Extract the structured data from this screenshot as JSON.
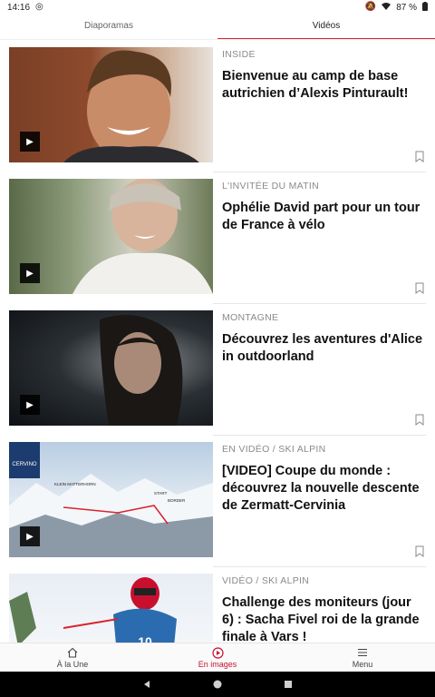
{
  "status_bar": {
    "time": "14:16",
    "battery": "87 %"
  },
  "tabs": [
    {
      "label": "Diaporamas",
      "active": false
    },
    {
      "label": "Vidéos",
      "active": true
    }
  ],
  "articles": [
    {
      "category": "INSIDE",
      "title": "Bienvenue au camp de base autrichien d’Alexis Pinturault!"
    },
    {
      "category": "L'INVITÉE DU MATIN",
      "title": "Ophélie David part pour un tour de France à vélo"
    },
    {
      "category": "MONTAGNE",
      "title": "Découvrez les aventures d'Alice in outdoorland"
    },
    {
      "category": "EN VIDÉO / SKI ALPIN",
      "title": "[VIDEO] Coupe du monde : découvrez la nouvelle descente de Zermatt-Cervinia"
    },
    {
      "category": "VIDÉO / SKI ALPIN",
      "title": "Challenge des moniteurs (jour 6) : Sacha Fivel roi de la grande finale à Vars !"
    }
  ],
  "thumb4_labels": {
    "zermatt_logo": "CERVINO",
    "klein": "KLEIN MATTERHORN",
    "start": "START",
    "border": "BORDER"
  },
  "thumb5_bib": "10",
  "bottom_nav": [
    {
      "label": "À la Une",
      "icon": "home-icon",
      "active": false
    },
    {
      "label": "En images",
      "icon": "play-circle-icon",
      "active": true
    },
    {
      "label": "Menu",
      "icon": "menu-icon",
      "active": false
    }
  ],
  "colors": {
    "accent": "#d9232e",
    "active_nav": "#c8102e"
  }
}
